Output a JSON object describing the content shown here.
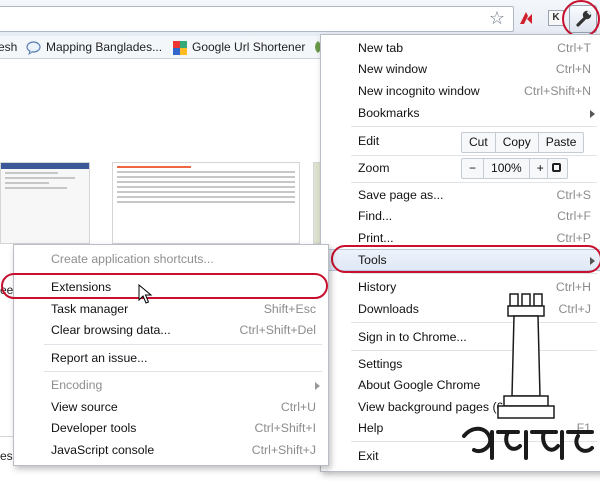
{
  "toolbar": {
    "icons": [
      "star-icon",
      "extension-icon",
      "k-extension-icon",
      "wrench-icon"
    ],
    "k_label": "K"
  },
  "bookmarks": {
    "items": [
      {
        "label": "esh"
      },
      {
        "label": "Mapping Banglades..."
      },
      {
        "label": "Google Url Shortener"
      }
    ]
  },
  "page": {
    "fragment_1": "ee",
    "fragment_2": "es"
  },
  "chrome_menu": {
    "new_tab": {
      "label": "New tab",
      "shortcut": "Ctrl+T"
    },
    "new_window": {
      "label": "New window",
      "shortcut": "Ctrl+N"
    },
    "new_incognito": {
      "label": "New incognito window",
      "shortcut": "Ctrl+Shift+N"
    },
    "bookmarks": {
      "label": "Bookmarks"
    },
    "edit": {
      "label": "Edit",
      "cut": "Cut",
      "copy": "Copy",
      "paste": "Paste"
    },
    "zoom": {
      "label": "Zoom",
      "minus": "−",
      "level": "100%",
      "plus": "+"
    },
    "save_page": {
      "label": "Save page as...",
      "shortcut": "Ctrl+S"
    },
    "find": {
      "label": "Find...",
      "shortcut": "Ctrl+F"
    },
    "print": {
      "label": "Print...",
      "shortcut": "Ctrl+P"
    },
    "tools": {
      "label": "Tools"
    },
    "history": {
      "label": "History",
      "shortcut": "Ctrl+H"
    },
    "downloads": {
      "label": "Downloads",
      "shortcut": "Ctrl+J"
    },
    "sign_in": {
      "label": "Sign in to Chrome..."
    },
    "settings": {
      "label": "Settings"
    },
    "about": {
      "label": "About Google Chrome"
    },
    "background_pages": {
      "label": "View background pages (6)"
    },
    "help": {
      "label": "Help",
      "shortcut": "F1"
    },
    "exit": {
      "label": "Exit"
    }
  },
  "tools_menu": {
    "create_shortcuts": {
      "label": "Create application shortcuts..."
    },
    "extensions": {
      "label": "Extensions"
    },
    "task_manager": {
      "label": "Task manager",
      "shortcut": "Shift+Esc"
    },
    "clear_browsing": {
      "label": "Clear browsing data...",
      "shortcut": "Ctrl+Shift+Del"
    },
    "report_issue": {
      "label": "Report an issue..."
    },
    "encoding": {
      "label": "Encoding"
    },
    "view_source": {
      "label": "View source",
      "shortcut": "Ctrl+U"
    },
    "developer_tools": {
      "label": "Developer tools",
      "shortcut": "Ctrl+Shift+I"
    },
    "js_console": {
      "label": "JavaScript console",
      "shortcut": "Ctrl+Shift+J"
    }
  },
  "colors": {
    "highlight_oval": "#c8102e",
    "menu_border": "#b9bec6",
    "hover_fill": "#dfe8f6"
  }
}
